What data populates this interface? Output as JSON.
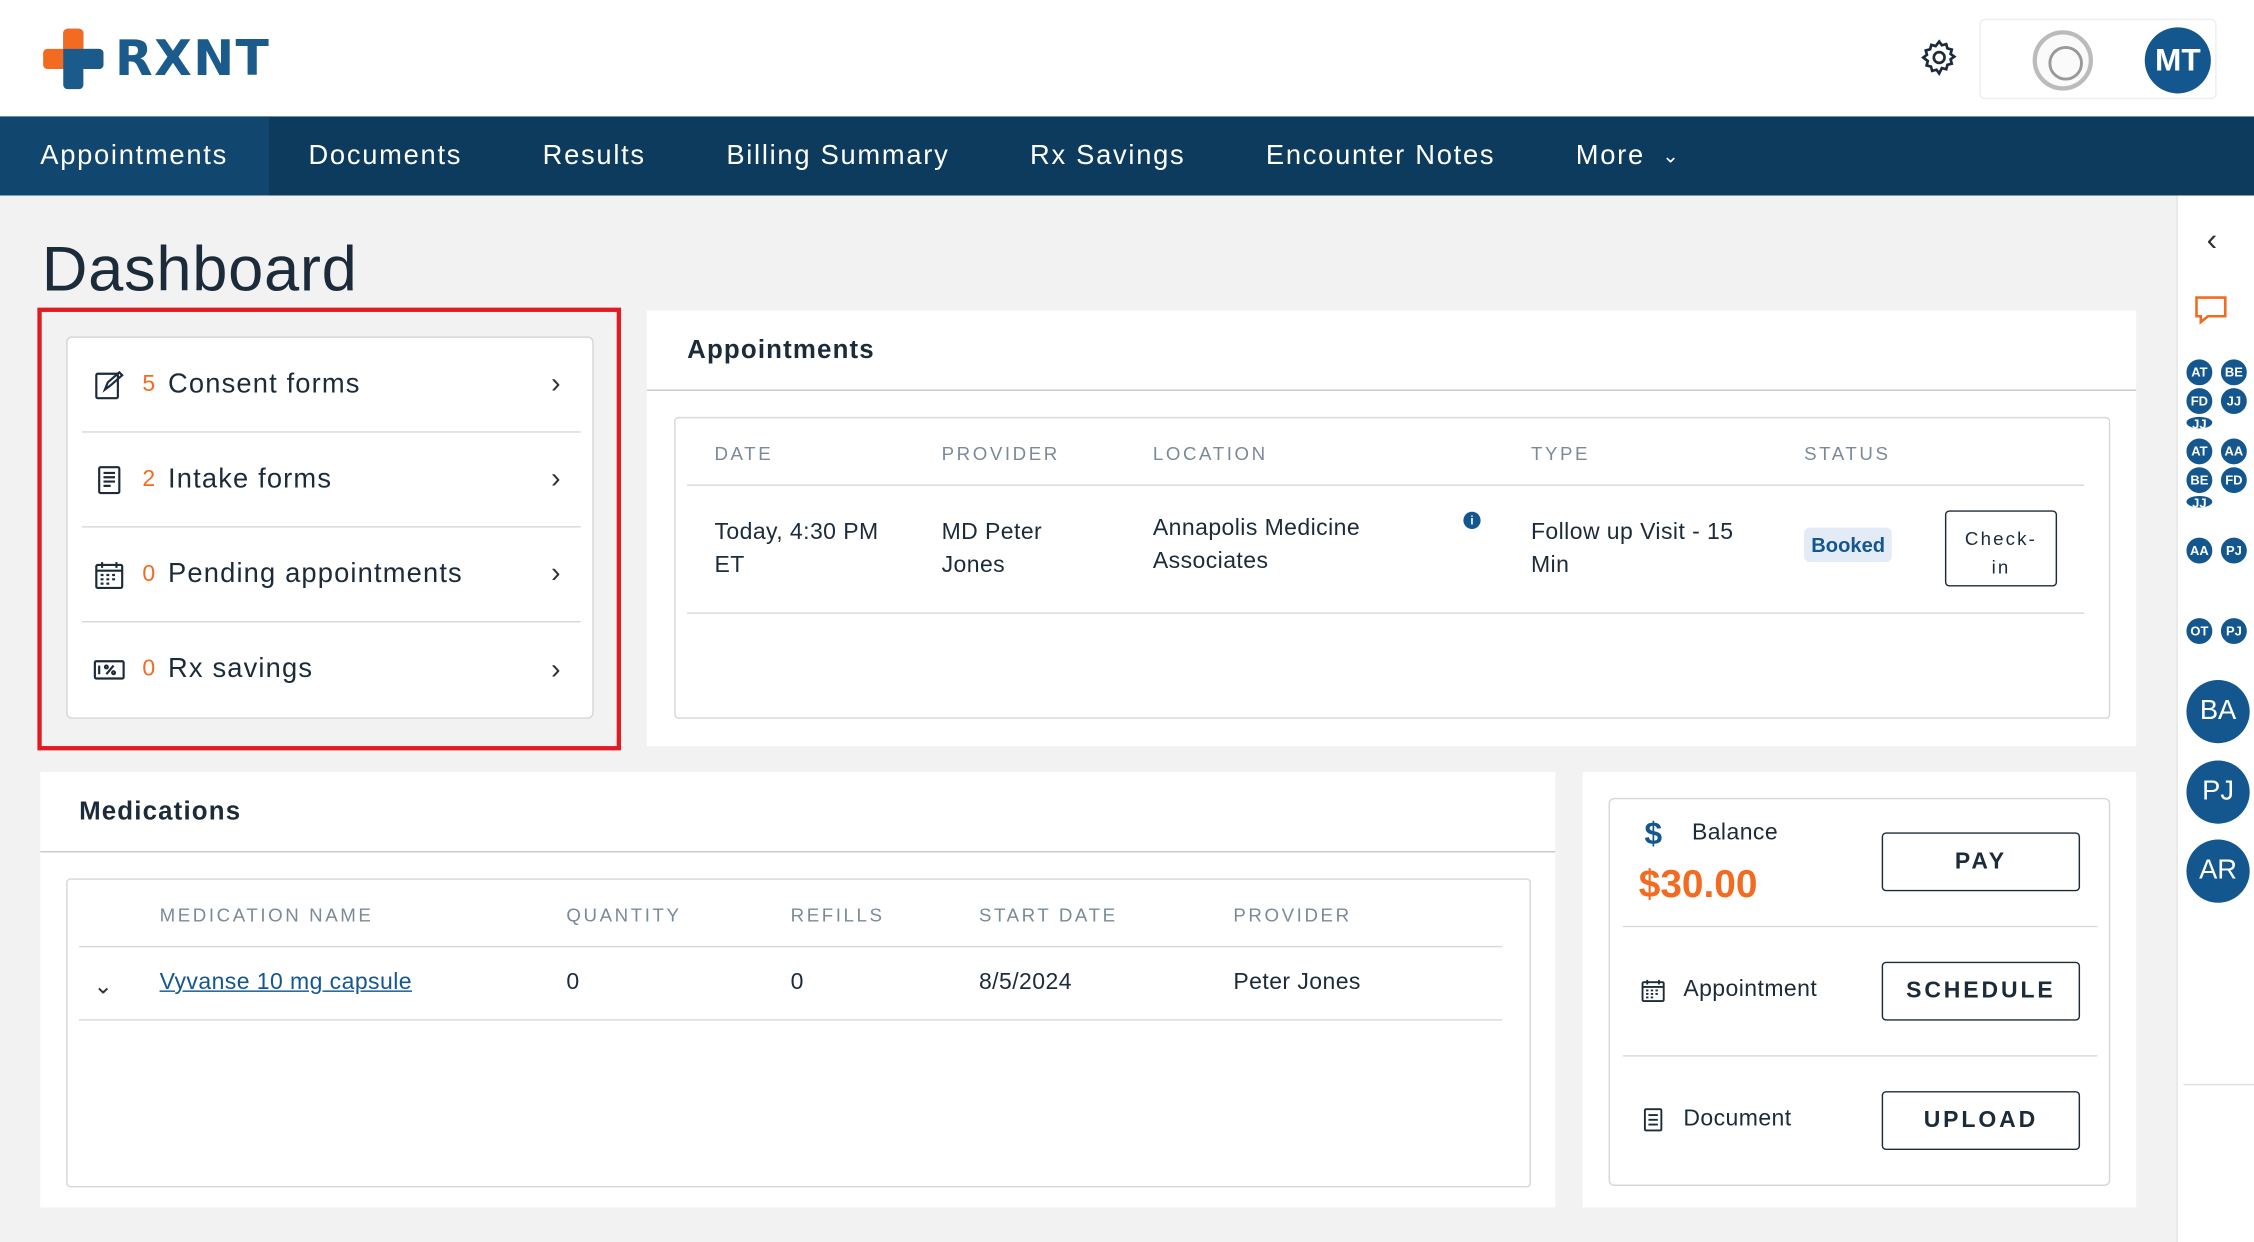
{
  "brand": {
    "name": "RXNT",
    "orange": "#f26b21",
    "blue": "#14578f",
    "navy": "#0c3b5e"
  },
  "header": {
    "user_initials": "MT"
  },
  "nav": {
    "items": [
      "Appointments",
      "Documents",
      "Results",
      "Billing Summary",
      "Rx Savings",
      "Encounter Notes",
      "More"
    ]
  },
  "page_title": "Dashboard",
  "quick_links": [
    {
      "count": "5",
      "label": "Consent forms",
      "icon": "consent-form-icon"
    },
    {
      "count": "2",
      "label": "Intake forms",
      "icon": "intake-form-icon"
    },
    {
      "count": "0",
      "label": "Pending appointments",
      "icon": "calendar-icon"
    },
    {
      "count": "0",
      "label": "Rx savings",
      "icon": "rx-savings-icon"
    }
  ],
  "appointments": {
    "title": "Appointments",
    "columns": [
      "DATE",
      "PROVIDER",
      "LOCATION",
      "TYPE",
      "STATUS"
    ],
    "rows": [
      {
        "date_line1": "Today, 4:30 PM",
        "date_line2": "ET",
        "provider_line1": "MD Peter",
        "provider_line2": "Jones",
        "location_line1": "Annapolis Medicine",
        "location_line2": "Associates",
        "type_line1": "Follow up Visit - 15",
        "type_line2": "Min",
        "status": "Booked",
        "action_line1": "Check-",
        "action_line2": "in"
      }
    ]
  },
  "medications": {
    "title": "Medications",
    "columns": [
      "MEDICATION NAME",
      "QUANTITY",
      "REFILLS",
      "START DATE",
      "PROVIDER"
    ],
    "rows": [
      {
        "name": "Vyvanse 10 mg capsule",
        "quantity": "0",
        "refills": "0",
        "start_date": "8/5/2024",
        "provider": "Peter Jones"
      }
    ]
  },
  "billing": {
    "balance_label": "Balance",
    "balance_amount": "$30.00",
    "pay_label": "PAY",
    "appointment_label": "Appointment",
    "schedule_label": "SCHEDULE",
    "document_label": "Document",
    "upload_label": "UPLOAD"
  },
  "rail": {
    "groups": [
      [
        "AT",
        "BE",
        "FD",
        "JJ",
        "JJ"
      ],
      [
        "AT",
        "AA",
        "BE",
        "FD",
        "JJ"
      ],
      [
        "AA",
        "PJ"
      ],
      [
        "OT",
        "PJ"
      ]
    ],
    "big_avatars": [
      "BA",
      "PJ",
      "AR"
    ]
  }
}
